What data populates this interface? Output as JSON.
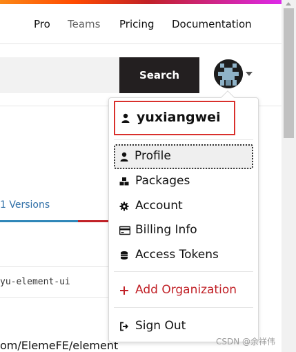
{
  "nav": {
    "links": [
      "Pro",
      "Teams",
      "Pricing",
      "Documentation"
    ]
  },
  "search": {
    "button_label": "Search",
    "placeholder": ""
  },
  "main": {
    "versions_tab": "1 Versions",
    "package_name": "yu-element-ui",
    "repository_text": "om/ElemeFE/element"
  },
  "dropdown": {
    "username": "yuxiangwei",
    "items": [
      {
        "label": "Profile",
        "icon": "user-icon"
      },
      {
        "label": "Packages",
        "icon": "packages-icon"
      },
      {
        "label": "Account",
        "icon": "gear-icon"
      },
      {
        "label": "Billing Info",
        "icon": "credit-card-icon"
      },
      {
        "label": "Access Tokens",
        "icon": "coins-icon"
      }
    ],
    "add_org": "Add Organization",
    "sign_out": "Sign Out"
  },
  "watermark": "CSDN @余祥伟",
  "colors": {
    "accent_red": "#c12127",
    "highlight_border": "#d9302c",
    "search_button": "#231f20",
    "tab_blue": "#2f86b8"
  }
}
